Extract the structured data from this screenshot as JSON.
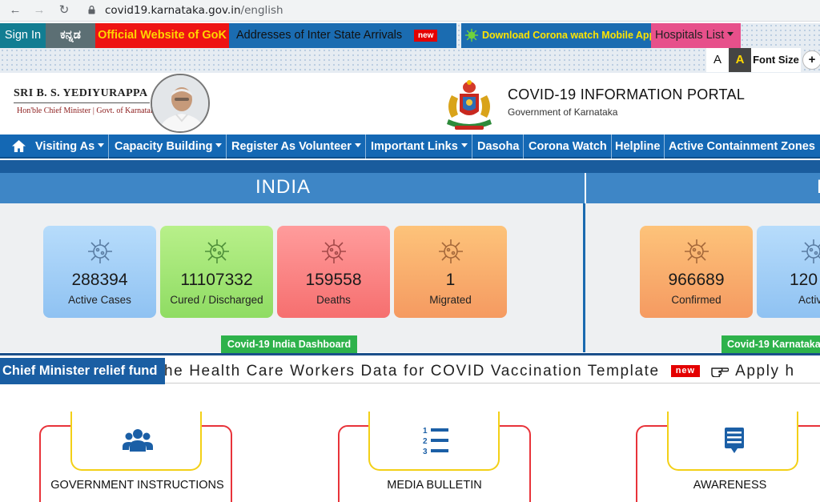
{
  "browser": {
    "url_host": "covid19.karnataka.gov.in",
    "url_path": "/english"
  },
  "topbar": {
    "signin": "Sign In",
    "kannada": "ಕನ್ನಡ",
    "official": "Official Website of GoK",
    "addresses": "Addresses of Inter State Arrivals",
    "new_badge": "new",
    "download": "Download Corona watch Mobile App",
    "hospitals": "Hospitals List"
  },
  "fontbar": {
    "a_small": "A",
    "a_large": "A",
    "label": "Font Size",
    "plus": "+"
  },
  "header": {
    "cm_name": "SRI B. S. YEDIYURAPPA",
    "cm_title": "Hon'ble Chief Minister | Govt. of Karnataka",
    "portal_title": "COVID-19 INFORMATION PORTAL",
    "portal_sub": "Government of Karnataka"
  },
  "nav": {
    "items": [
      {
        "label": "Visiting As",
        "dropdown": true
      },
      {
        "label": "Capacity Building",
        "dropdown": true
      },
      {
        "label": "Register As Volunteer",
        "dropdown": true
      },
      {
        "label": "Important Links",
        "dropdown": true
      },
      {
        "label": "Dasoha",
        "dropdown": false
      },
      {
        "label": "Corona Watch",
        "dropdown": false
      },
      {
        "label": "Helpline",
        "dropdown": false
      },
      {
        "label": "Active Containment Zones",
        "dropdown": false
      }
    ]
  },
  "india": {
    "title": "INDIA",
    "cards": [
      {
        "value": "288394",
        "label": "Active Cases"
      },
      {
        "value": "11107332",
        "label": "Cured / Discharged"
      },
      {
        "value": "159558",
        "label": "Deaths"
      },
      {
        "value": "1",
        "label": "Migrated"
      }
    ],
    "dashboard_button": "Covid-19 India Dashboard"
  },
  "karnataka": {
    "title": "K",
    "cards": [
      {
        "value": "966689",
        "label": "Confirmed"
      },
      {
        "value": "120",
        "label": "Activ"
      }
    ],
    "dashboard_button": "Covid-19 Karnataka"
  },
  "ticker": {
    "relief": "Chief Minister relief fund",
    "marquee_text": "he Health Care Workers Data for COVID Vaccination Template",
    "new_tag": "new",
    "apply_text": "Apply h"
  },
  "tiles": [
    {
      "label": "GOVERNMENT INSTRUCTIONS",
      "icon": "users-icon"
    },
    {
      "label": "MEDIA BULLETIN",
      "icon": "numbered-list-icon"
    },
    {
      "label": "AWARENESS",
      "icon": "chat-list-icon"
    }
  ],
  "colors": {
    "nav_blue": "#1468b4",
    "official_red": "#ee1313",
    "dashboard_green": "#2eb24b",
    "tile_red": "#e8333a",
    "tile_yellow": "#f3d017"
  }
}
